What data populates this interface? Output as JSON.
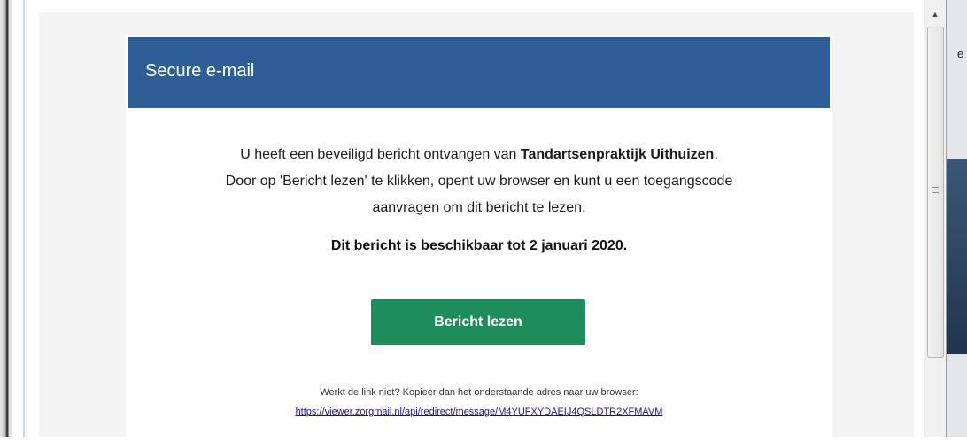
{
  "email": {
    "header_title": "Secure e-mail",
    "intro_prefix": "U heeft een beveiligd bericht ontvangen van ",
    "sender_name": "Tandartsenpraktijk Uithuizen",
    "intro_suffix": ".",
    "line2": "Door op 'Bericht lezen' te klikken, opent uw browser en kunt u een toegangscode",
    "line3": "aanvragen om dit bericht te lezen.",
    "availability": "Dit bericht is beschikbaar tot 2 januari 2020.",
    "button_label": "Bericht lezen",
    "hint": "Werkt de link niet? Kopieer dan het onderstaande adres naar uw browser:",
    "link_url": "https://viewer.zorgmail.nl/api/redirect/message/M4YUFXYDAEIJ4QSLDTR2XFMAVM"
  },
  "background": {
    "right_fragment": "e"
  },
  "colors": {
    "header_bg": "#2e5e95",
    "button_bg": "#1e8c5b",
    "link": "#1a0dab"
  },
  "icons": {
    "scroll_up": "chevron-up-icon",
    "grip": "scroll-grip-icon"
  }
}
